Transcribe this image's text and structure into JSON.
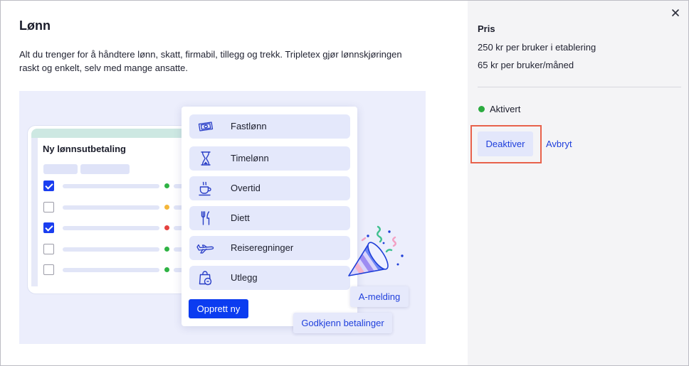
{
  "modal": {
    "title": "Lønn",
    "description_lines": [
      "Alt du trenger for å håndtere lønn, skatt, firmabil, tillegg og trekk. Tripletex gjør lønnskjøringen",
      "raskt og enkelt, selv med mange ansatte."
    ]
  },
  "illustration": {
    "payroll_card": {
      "title": "Ny lønnsutbetaling",
      "rows": [
        {
          "checked": true,
          "status_color": "#2fb344"
        },
        {
          "checked": false,
          "status_color": "#f4b63a"
        },
        {
          "checked": true,
          "status_color": "#e5423f"
        },
        {
          "checked": false,
          "status_color": "#2fb344"
        },
        {
          "checked": false,
          "status_color": "#2fb344"
        }
      ]
    },
    "menu": {
      "items": [
        {
          "label": "Fastlønn",
          "icon": "banknote-icon"
        },
        {
          "label": "Timelønn",
          "icon": "hourglass-icon"
        },
        {
          "label": "Overtid",
          "icon": "coffee-cup-icon"
        },
        {
          "label": "Diett",
          "icon": "cutlery-icon"
        },
        {
          "label": "Reiseregninger",
          "icon": "airplane-icon"
        },
        {
          "label": "Utlegg",
          "icon": "shopping-bag-icon"
        }
      ],
      "create_button": "Opprett ny"
    },
    "chips": {
      "a_melding": "A-melding",
      "approve_payments": "Godkjenn betalinger"
    },
    "decoration_icon": "party-popper-icon"
  },
  "sidebar": {
    "close_icon": "close-icon",
    "price_heading": "Pris",
    "price_lines": [
      "250 kr per bruker i etablering",
      "65 kr per bruker/måned"
    ],
    "status": {
      "label": "Aktivert",
      "color": "#2bab3f"
    },
    "deactivate_button": "Deaktiver",
    "cancel_link": "Avbryt"
  },
  "colors": {
    "accent_blue": "#0b3cf0",
    "link_blue": "#1f3fdc",
    "panel_background": "#f4f4f6",
    "illustration_background": "#eceefc",
    "highlight_outline": "#e8624b"
  }
}
